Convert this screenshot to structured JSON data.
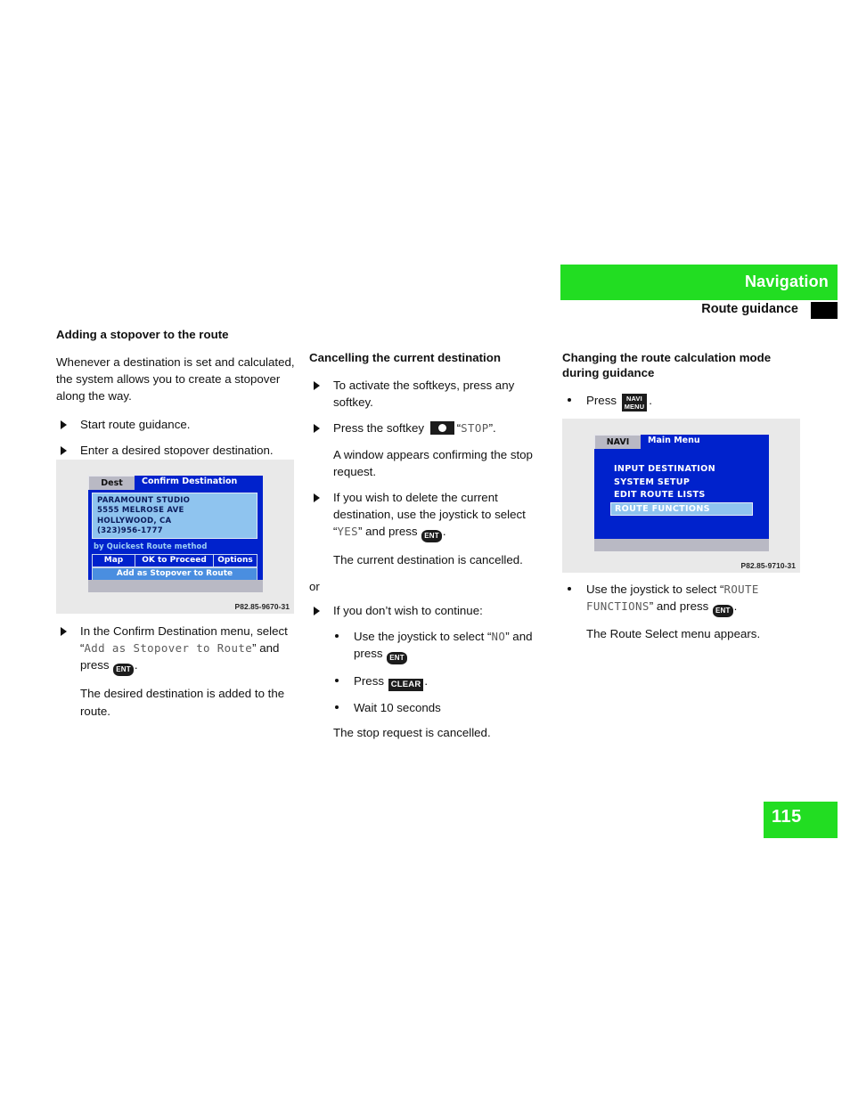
{
  "header": {
    "title": "Navigation",
    "subtitle": "Route guidance"
  },
  "page_number": "115",
  "columns": {
    "left": {
      "heading": "Adding a stopover to the route",
      "intro": "Whenever a destination is set and calculated, the system allows you to create a stopover along the way.",
      "steps": [
        "Start route guidance.",
        "Enter a desired stopover destination."
      ],
      "after_figure": {
        "step_text_1": "In the Confirm Destination menu, select “",
        "step_mono": "Add as Stopover to Route",
        "step_text_2": "” and press ",
        "key": "ENT",
        "step_text_3": ".",
        "result": "The desired destination is added to the route."
      },
      "figure": {
        "caption": "P82.85-9670-31",
        "tab": "Dest",
        "title": "Confirm Destination",
        "address": [
          "PARAMOUNT STUDIO",
          "5555 MELROSE AVE",
          "HOLLYWOOD, CA",
          "(323)956-1777"
        ],
        "method": "by Quickest Route method",
        "softkeys": [
          "Map",
          "OK to Proceed",
          "Options"
        ],
        "highlight": "Add as Stopover to Route"
      }
    },
    "mid": {
      "heading": "Cancelling the current destination",
      "step1": "To activate the softkeys, press any softkey.",
      "step2_pre": "Press the softkey ",
      "step2_icon": "softkey",
      "step2_quote_open": "“",
      "step2_mono": "STOP",
      "step2_quote_close": "”.",
      "note1": "A window appears confirming the stop request.",
      "step3_pre": "If you wish to delete the current destination, use the joystick to select “",
      "step3_mono": "YES",
      "step3_mid": "” and press ",
      "step3_key": "ENT",
      "step3_end": ".",
      "note2": "The current destination is cancelled.",
      "or": "or",
      "step4": "If you don’t wish to continue:",
      "sub1_pre": "Use the joystick to select “",
      "sub1_mono": "NO",
      "sub1_mid": "” and press ",
      "sub1_key": "ENT",
      "sub2_pre": "Press ",
      "sub2_key": "CLEAR",
      "sub2_end": ".",
      "sub3": "Wait 10 seconds",
      "note3": "The stop request is cancelled."
    },
    "right": {
      "heading": "Changing the route calculation mode during guidance",
      "step1_pre": "Press ",
      "step1_key_line1": "NAVI",
      "step1_key_line2": "MENU",
      "step1_end": ".",
      "after_figure": {
        "step_pre": "Use the joystick to select “",
        "step_mono": "ROUTE FUNCTIONS",
        "step_mid": "” and press ",
        "step_key": "ENT",
        "step_end": ".",
        "result": "The Route Select menu appears."
      },
      "figure": {
        "caption": "P82.85-9710-31",
        "tab": "NAVI",
        "title": "Main Menu",
        "menu_items": [
          "INPUT DESTINATION",
          "SYSTEM SETUP",
          "EDIT ROUTE LISTS",
          "ROUTE FUNCTIONS"
        ],
        "selected_index": 3
      }
    }
  }
}
